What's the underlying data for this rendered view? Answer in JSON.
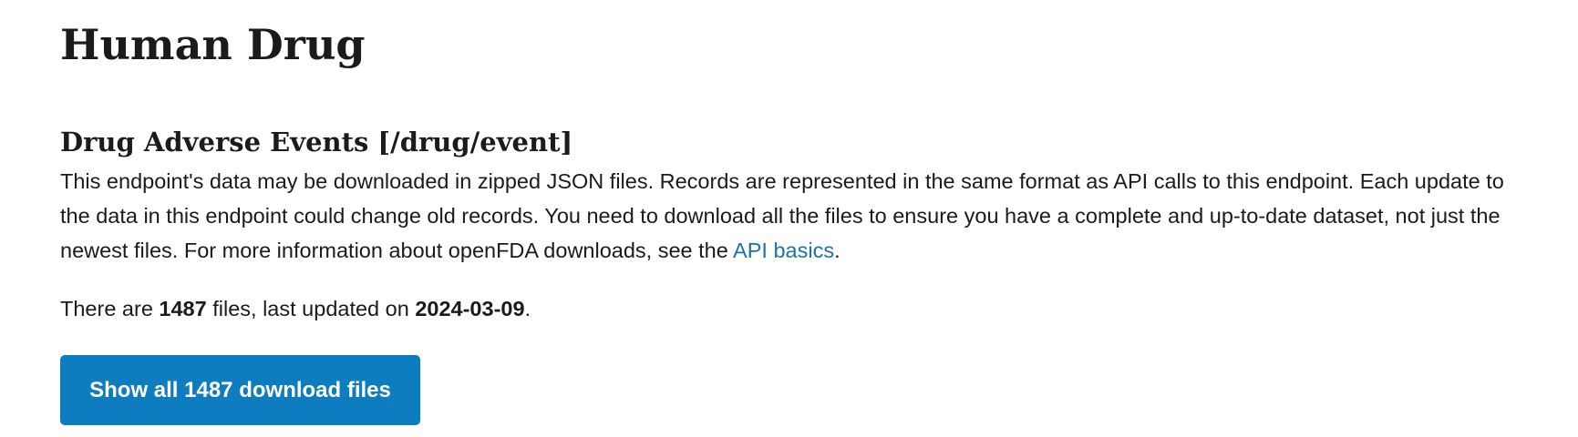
{
  "page": {
    "title": "Human Drug"
  },
  "section": {
    "title": "Drug Adverse Events [/drug/event]",
    "description_text": "This endpoint's data may be downloaded in zipped JSON files. Records are represented in the same format as API calls to this endpoint. Each update to the data in this endpoint could change old records. You need to download all the files to ensure you have a complete and up-to-date dataset, not just the newest files. For more information about openFDA downloads, see the ",
    "link_text": "API basics",
    "description_end": "."
  },
  "file_info": {
    "prefix": "There are ",
    "count": "1487",
    "middle": " files, last updated on ",
    "date": "2024-03-09",
    "suffix": "."
  },
  "button": {
    "label": "Show all 1487 download files"
  },
  "colors": {
    "link": "#1a73a8",
    "button_bg": "#0d7dbf",
    "button_text": "#ffffff",
    "text": "#1b1b1b"
  }
}
